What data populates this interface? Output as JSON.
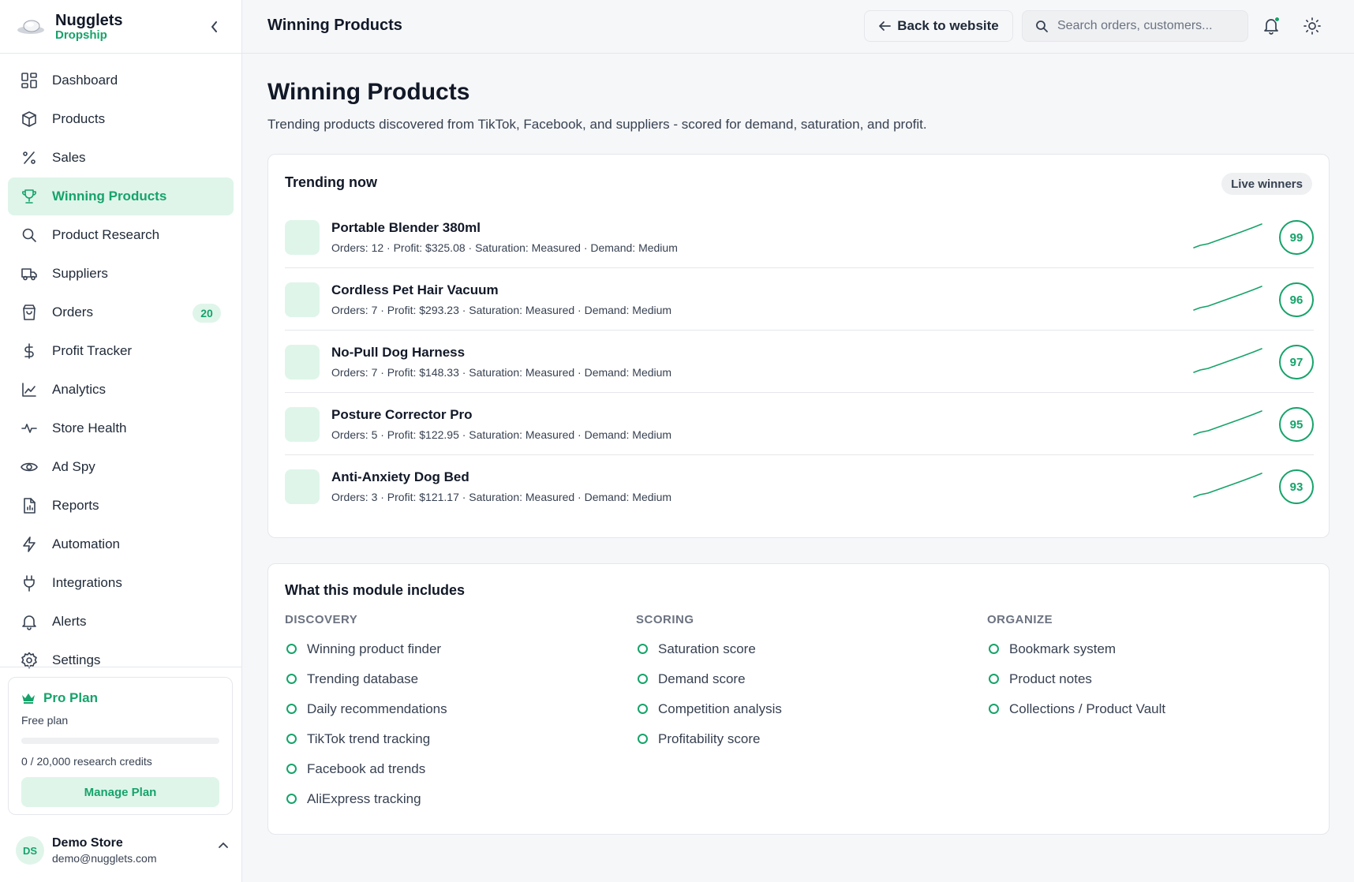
{
  "brand": {
    "name": "Nugglets",
    "sub": "Dropship"
  },
  "sidebar": {
    "items": [
      {
        "label": "Dashboard",
        "icon": "dashboard-icon"
      },
      {
        "label": "Products",
        "icon": "box-icon"
      },
      {
        "label": "Sales",
        "icon": "percent-icon"
      },
      {
        "label": "Winning Products",
        "icon": "trophy-icon",
        "active": true
      },
      {
        "label": "Product Research",
        "icon": "search-icon"
      },
      {
        "label": "Suppliers",
        "icon": "truck-icon"
      },
      {
        "label": "Orders",
        "icon": "bag-icon",
        "badge": "20"
      },
      {
        "label": "Profit Tracker",
        "icon": "dollar-icon"
      },
      {
        "label": "Analytics",
        "icon": "chart-icon"
      },
      {
        "label": "Store Health",
        "icon": "pulse-icon"
      },
      {
        "label": "Ad Spy",
        "icon": "eye-icon"
      },
      {
        "label": "Reports",
        "icon": "report-icon"
      },
      {
        "label": "Automation",
        "icon": "zap-icon"
      },
      {
        "label": "Integrations",
        "icon": "plug-icon"
      },
      {
        "label": "Alerts",
        "icon": "bell-icon"
      },
      {
        "label": "Settings",
        "icon": "gear-icon"
      }
    ]
  },
  "plan": {
    "title": "Pro Plan",
    "sub": "Free plan",
    "credits": "0 / 20,000 research credits",
    "progress": 0,
    "manage_label": "Manage Plan"
  },
  "user": {
    "initials": "DS",
    "name": "Demo Store",
    "email": "demo@nugglets.com"
  },
  "topbar": {
    "title": "Winning Products",
    "back_label": "Back to website",
    "search_placeholder": "Search orders, customers..."
  },
  "page": {
    "title": "Winning Products",
    "subtitle": "Trending products discovered from TikTok, Facebook, and suppliers - scored for demand, saturation, and profit."
  },
  "trending": {
    "title": "Trending now",
    "badge": "Live winners",
    "products": [
      {
        "name": "Portable Blender 380ml",
        "meta": "Orders: 12 · Profit: $325.08 · Saturation: Measured · Demand: Medium",
        "score": "99"
      },
      {
        "name": "Cordless Pet Hair Vacuum",
        "meta": "Orders: 7 · Profit: $293.23 · Saturation: Measured · Demand: Medium",
        "score": "96"
      },
      {
        "name": "No-Pull Dog Harness",
        "meta": "Orders: 7 · Profit: $148.33 · Saturation: Measured · Demand: Medium",
        "score": "97"
      },
      {
        "name": "Posture Corrector Pro",
        "meta": "Orders: 5 · Profit: $122.95 · Saturation: Measured · Demand: Medium",
        "score": "95"
      },
      {
        "name": "Anti-Anxiety Dog Bed",
        "meta": "Orders: 3 · Profit: $121.17 · Saturation: Measured · Demand: Medium",
        "score": "93"
      }
    ]
  },
  "module": {
    "title": "What this module includes",
    "columns": [
      {
        "heading": "DISCOVERY",
        "items": [
          "Winning product finder",
          "Trending database",
          "Daily recommendations",
          "TikTok trend tracking",
          "Facebook ad trends",
          "AliExpress tracking"
        ]
      },
      {
        "heading": "SCORING",
        "items": [
          "Saturation score",
          "Demand score",
          "Competition analysis",
          "Profitability score"
        ]
      },
      {
        "heading": "ORGANIZE",
        "items": [
          "Bookmark system",
          "Product notes",
          "Collections / Product Vault"
        ]
      }
    ]
  },
  "colors": {
    "accent": "#16a36a",
    "accent_bg": "#dff5ea"
  }
}
